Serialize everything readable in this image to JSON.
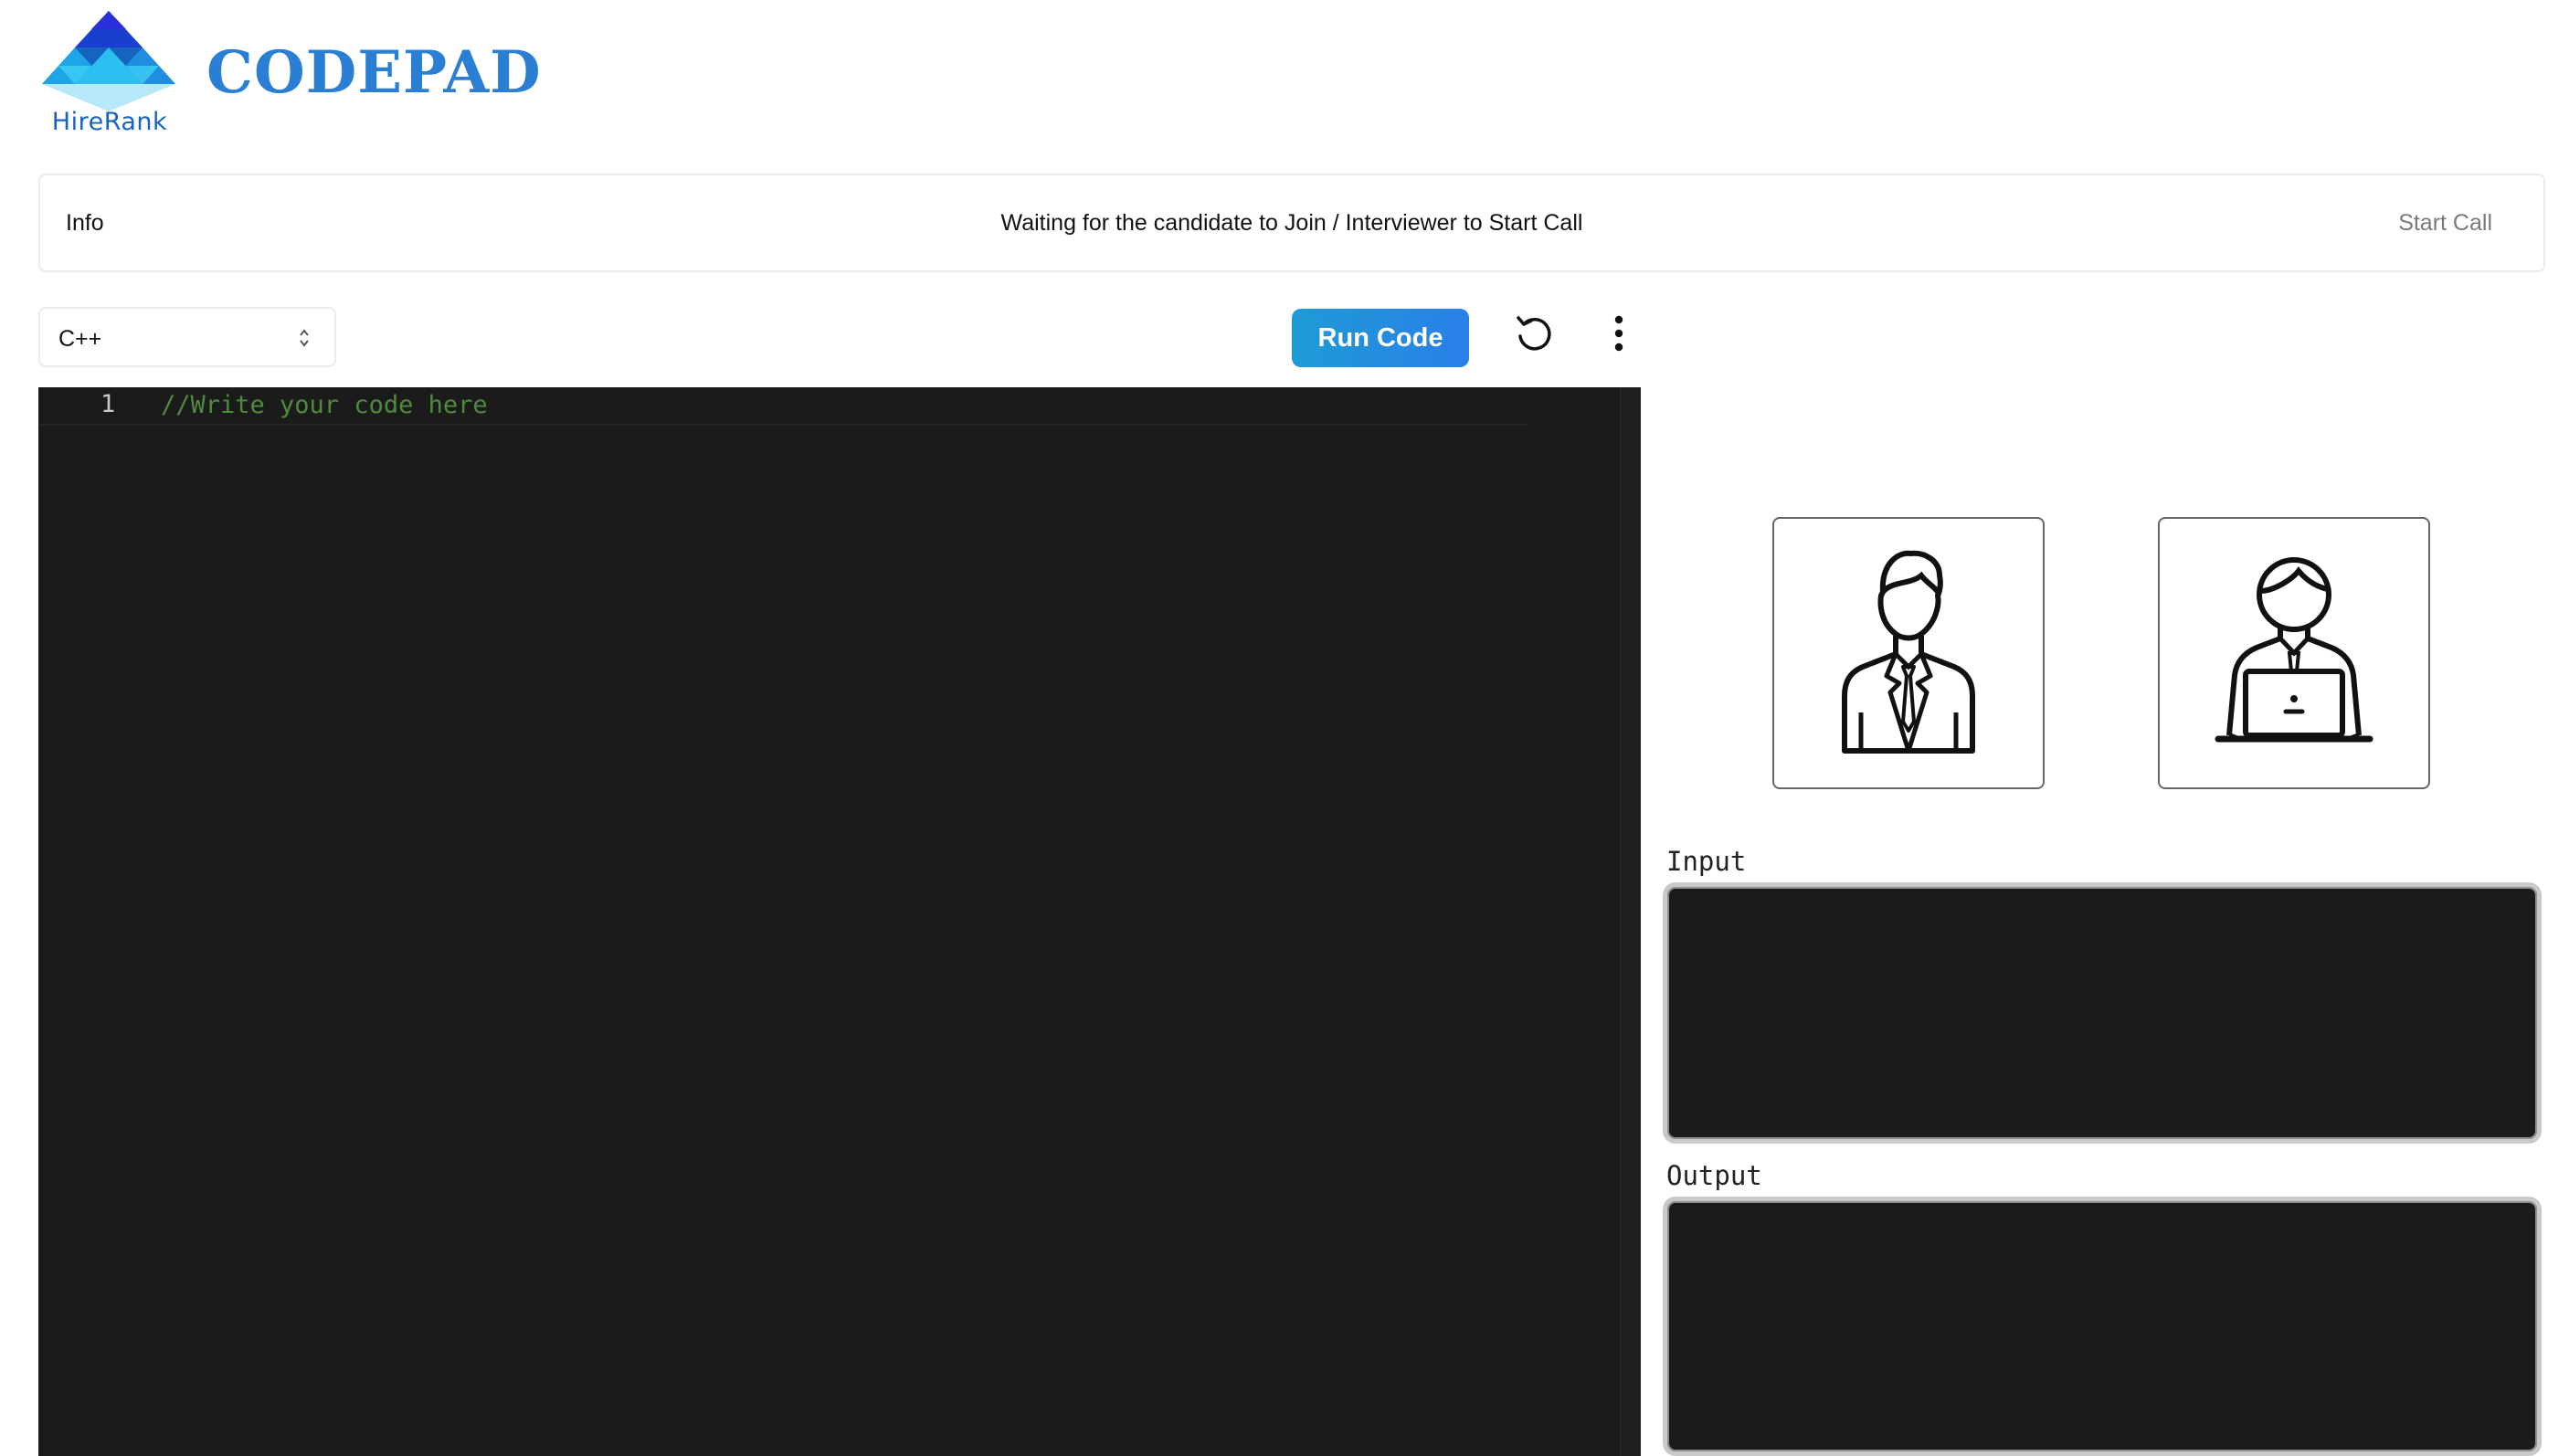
{
  "header": {
    "logo_text": "HireRank",
    "brand": "CODEPAD"
  },
  "info_bar": {
    "label": "Info",
    "status": "Waiting for the candidate to Join / Interviewer to Start Call",
    "start_call": "Start Call"
  },
  "toolbar": {
    "language": "C++",
    "run_label": "Run Code",
    "reset_icon": "reset-icon",
    "more_icon": "more-vertical-icon"
  },
  "editor": {
    "lines": [
      {
        "number": "1",
        "text": "//Write your code here"
      }
    ]
  },
  "video": {
    "interviewer_icon": "interviewer-avatar-icon",
    "candidate_icon": "candidate-avatar-icon"
  },
  "io": {
    "input_label": "Input",
    "input_value": "",
    "output_label": "Output",
    "output_value": ""
  },
  "colors": {
    "brand": "#2a7fd4",
    "run_button_start": "#1e9bd6",
    "run_button_end": "#2a7fe8",
    "editor_bg": "#1b1b1b",
    "comment": "#4e8a3e"
  }
}
